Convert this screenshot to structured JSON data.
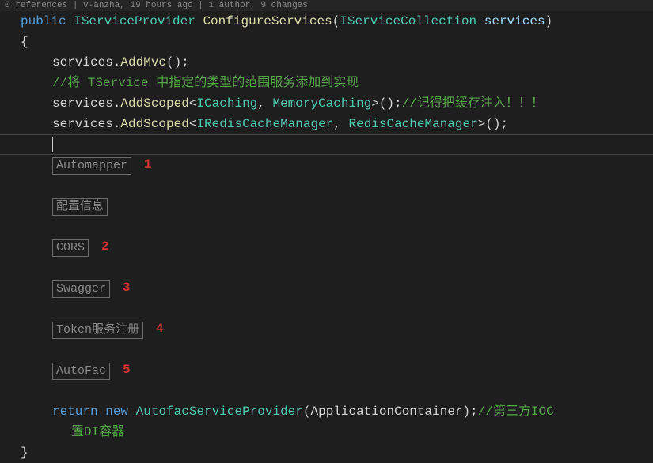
{
  "codelens": {
    "references": "0 references",
    "author": "v-anzha, 19 hours ago",
    "history": "1 author, 9 changes"
  },
  "signature": {
    "public": "public",
    "returnType": "IServiceProvider",
    "methodName": "ConfigureServices",
    "paramType": "IServiceCollection",
    "paramName": "services"
  },
  "openBrace": "{",
  "closeBrace": "}",
  "body": {
    "line1": {
      "obj": "services",
      "call": "AddMvc",
      "tail": "();"
    },
    "comment1": "//将 TService 中指定的类型的范围服务添加到实现",
    "line2": {
      "obj": "services",
      "call": "AddScoped",
      "lt": "<",
      "t1": "ICaching",
      "sep": ", ",
      "t2": "MemoryCaching",
      "gt": ">();",
      "comment": "//记得把缓存注入！！！"
    },
    "line3": {
      "obj": "services",
      "call": "AddScoped",
      "lt": "<",
      "t1": "IRedisCacheManager",
      "sep": ", ",
      "t2": "RedisCacheManager",
      "gt": ">();"
    }
  },
  "regions": [
    {
      "label": "Automapper",
      "num": "1"
    },
    {
      "label": "配置信息",
      "num": ""
    },
    {
      "label": "CORS",
      "num": "2"
    },
    {
      "label": "Swagger",
      "num": "3"
    },
    {
      "label": "Token服务注册",
      "num": "4"
    },
    {
      "label": "AutoFac",
      "num": "5"
    }
  ],
  "return": {
    "ret": "return",
    "new": "new",
    "type": "AutofacServiceProvider",
    "open": "(",
    "arg": "ApplicationContainer",
    "close": ");",
    "comment": "//第三方IOC",
    "commentCont": "置DI容器"
  }
}
